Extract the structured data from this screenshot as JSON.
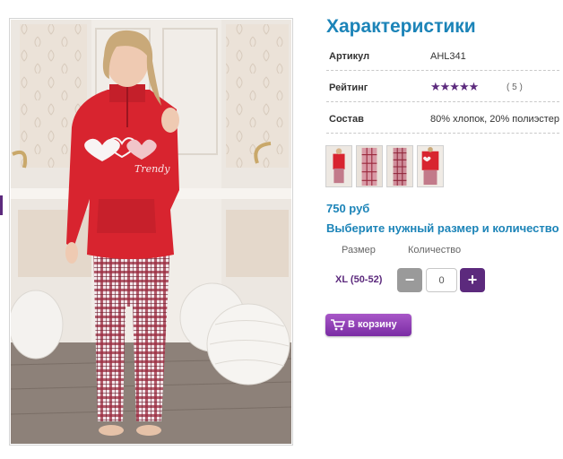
{
  "specs": {
    "title": "Характеристики",
    "article_label": "Артикул",
    "article_value": "AHL341",
    "rating_label": "Рейтинг",
    "rating_stars": "★★★★★",
    "rating_count": "( 5 )",
    "rating_value": 5,
    "composition_label": "Состав",
    "composition_value": "80% хлопок, 20% полиэстер"
  },
  "graphic_text": "Trendy",
  "gallery": {
    "thumbnails": [
      "thumb-1",
      "thumb-2",
      "thumb-3",
      "thumb-4"
    ]
  },
  "price": "750 руб",
  "choose_text": "Выберите нужный размер и количество",
  "order": {
    "size_header": "Размер",
    "qty_header": "Количество",
    "size_value": "XL (50-52)",
    "minus": "−",
    "plus": "+",
    "qty_value": "0"
  },
  "cart_button": {
    "label": "В корзину",
    "icon": "cart-icon"
  },
  "colors": {
    "accent_blue": "#1c84b8",
    "accent_purple": "#5c2a7d",
    "button_purple": "#8c3cb4"
  }
}
